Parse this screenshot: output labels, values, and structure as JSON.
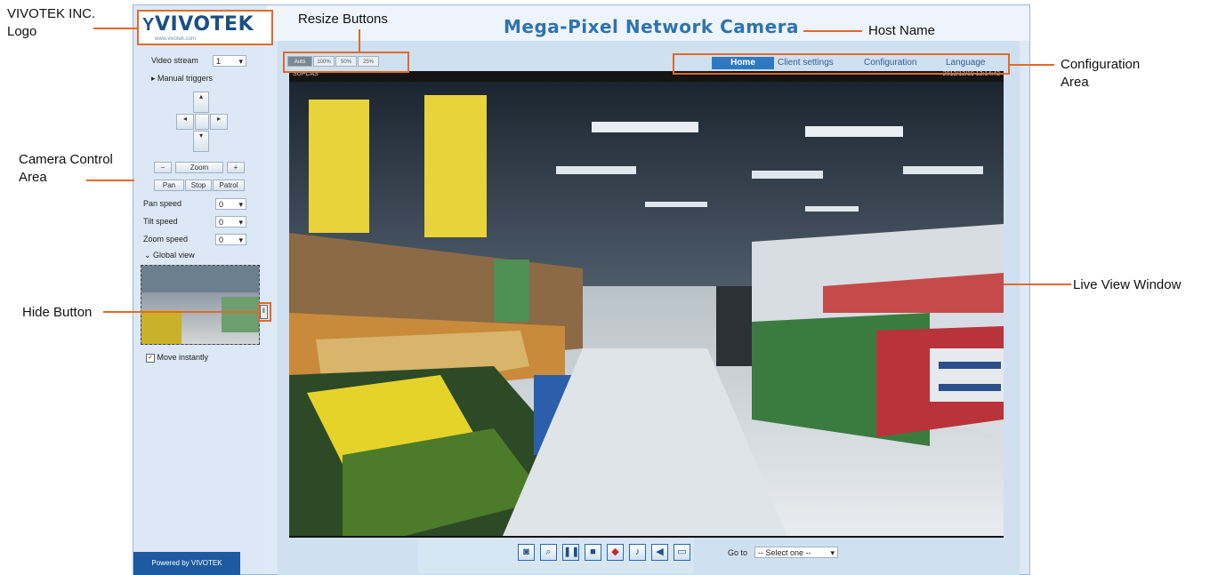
{
  "header": {
    "host_name": "Mega-Pixel Network Camera"
  },
  "logo": {
    "text": "VIVOTEK",
    "tagline": "www.vivotek.com"
  },
  "nav": {
    "items": [
      "Home",
      "Client settings",
      "Configuration",
      "Language"
    ],
    "active": "Home"
  },
  "resize": {
    "items": [
      "Auto",
      "100%",
      "50%",
      "25%"
    ]
  },
  "left_panel": {
    "video_stream_label": "Video stream",
    "video_stream_value": "1",
    "manual_triggers": "Manual triggers",
    "zoom_label": "Zoom",
    "zoom_minus": "−",
    "zoom_plus": "+",
    "pan_label": "Pan",
    "stop_label": "Stop",
    "patrol_label": "Patrol",
    "pan_speed_label": "Pan speed",
    "pan_speed_value": "0",
    "tilt_speed_label": "Tilt speed",
    "tilt_speed_value": "0",
    "zoom_speed_label": "Zoom speed",
    "zoom_speed_value": "0",
    "global_view_label": "Global view",
    "move_instantly_label": "Move instantly",
    "powered_by": "Powered by VIVOTEK"
  },
  "video": {
    "overlay_left": "SUPCAS",
    "overlay_right": "2012/12/19 13:14:43"
  },
  "toolbar": {
    "tools": [
      "snapshot",
      "digital-zoom",
      "pause",
      "stop",
      "record",
      "volume",
      "talk",
      "full-screen"
    ],
    "goto_label": "Go to",
    "goto_value": "-- Select one --"
  },
  "annotations": {
    "logo": "VIVOTEK INC.\nLogo",
    "resize": "Resize Buttons",
    "host_name": "Host Name",
    "config": "Configuration\nArea",
    "camera_control": "Camera Control\nArea",
    "hide": "Hide Button",
    "live_view": "Live View Window"
  },
  "colors": {
    "accent": "#2f79c2",
    "annotation": "#e06a2c",
    "panel": "#dce8f5"
  }
}
